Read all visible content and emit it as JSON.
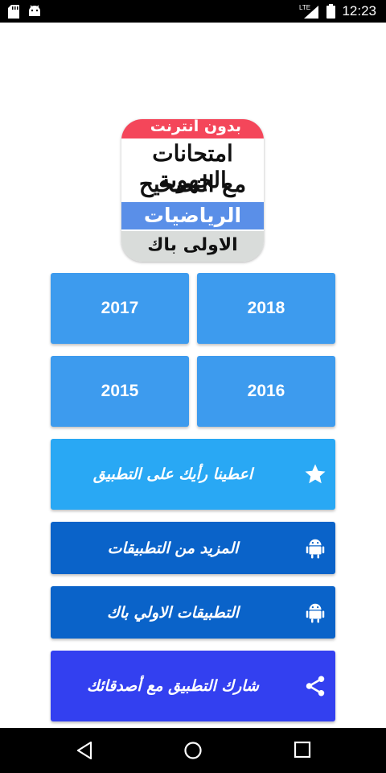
{
  "status_bar": {
    "time": "12:23",
    "network": "LTE",
    "icons": [
      "sd-card-icon",
      "android-icon",
      "lte-icon",
      "signal-icon",
      "battery-icon"
    ]
  },
  "logo": {
    "top_text": "بدون أنترنت",
    "line1": "امتحانات الجهوية",
    "line2": "مع التصحيح",
    "subject": "الرياضيات",
    "level": "الاولى باك"
  },
  "years": {
    "y2018": "2018",
    "y2017": "2017",
    "y2016": "2016",
    "y2015": "2015"
  },
  "actions": {
    "rate": "اعطينا رأيك على التطبيق",
    "more_apps": "المزيد من التطبيقات",
    "first_bac_apps": "التطبيقات الاولي باك",
    "share": "شارك التطبيق مع أصدقائك"
  },
  "colors": {
    "year_button": "#3d9bee",
    "rate_button": "#29a8f4",
    "apps_button": "#0a63c9",
    "share_button": "#3340f0"
  }
}
